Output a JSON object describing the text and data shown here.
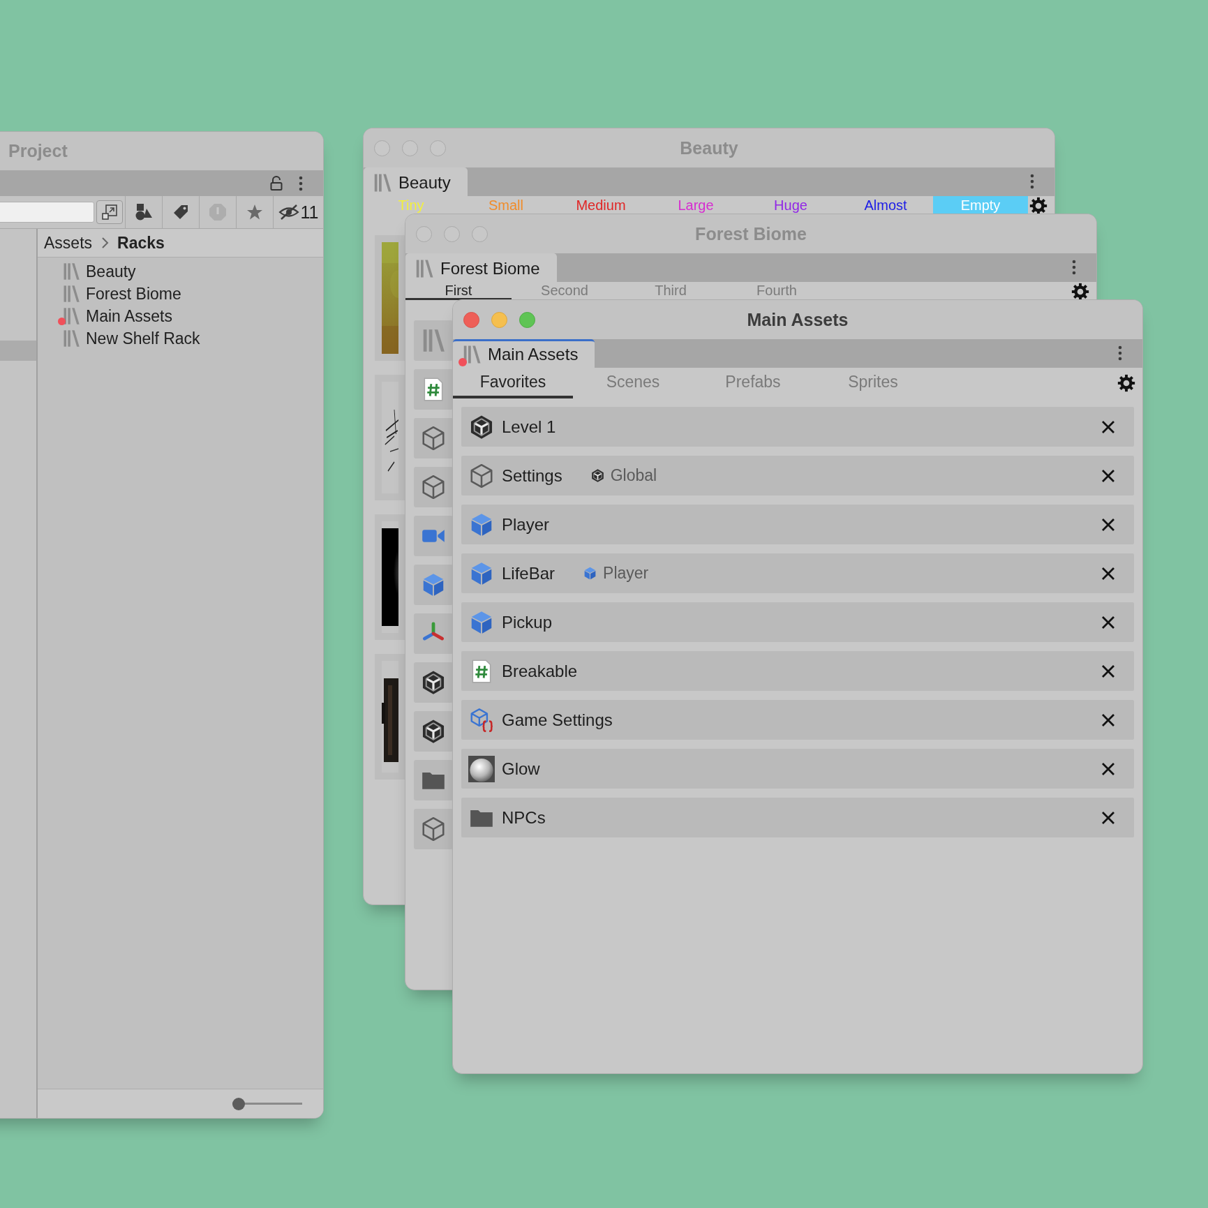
{
  "project_window": {
    "title": "Project",
    "sidebar": {
      "row_selected": true
    },
    "filter_buttons": [
      {
        "kind": "type",
        "disabled": false
      },
      {
        "kind": "label",
        "disabled": false
      },
      {
        "kind": "log",
        "disabled": true
      },
      {
        "kind": "favorite",
        "disabled": false
      }
    ],
    "hidden_count": "11",
    "breadcrumb": [
      {
        "label": "Assets",
        "current": false
      },
      {
        "label": "Racks",
        "current": true
      }
    ],
    "items": [
      {
        "label": "Beauty",
        "modified": false
      },
      {
        "label": "Forest Biome",
        "modified": false
      },
      {
        "label": "Main Assets",
        "modified": true
      },
      {
        "label": "New Shelf Rack",
        "modified": false
      }
    ],
    "zoom_slider": {
      "level": 0
    }
  },
  "beauty_window": {
    "title": "Beauty",
    "active": false,
    "tab": {
      "label": "Beauty",
      "modified": false,
      "focused": false
    },
    "subtabs": [
      {
        "label": "Tiny",
        "color": "#f2f03c",
        "selected": false
      },
      {
        "label": "Small",
        "color": "#f08c2a",
        "selected": false
      },
      {
        "label": "Medium",
        "color": "#e02626",
        "selected": false
      },
      {
        "label": "Large",
        "color": "#d62cd0",
        "selected": false
      },
      {
        "label": "Huge",
        "color": "#9126e6",
        "selected": false
      },
      {
        "label": "Almost",
        "color": "#1c1ce6",
        "selected": false
      },
      {
        "label": "Empty",
        "color": "#5bcdf5",
        "selected": true
      }
    ]
  },
  "forest_window": {
    "title": "Forest Biome",
    "active": false,
    "tab": {
      "label": "Forest Biome",
      "modified": false,
      "focused": false
    },
    "subtabs": [
      {
        "label": "First",
        "selected": true
      },
      {
        "label": "Second",
        "selected": false
      },
      {
        "label": "Third",
        "selected": false
      },
      {
        "label": "Fourth",
        "selected": false
      }
    ],
    "sidebar_icons": [
      {
        "kind": "rack"
      },
      {
        "kind": "script"
      },
      {
        "kind": "box"
      },
      {
        "kind": "box"
      },
      {
        "kind": "camera"
      },
      {
        "kind": "prefab"
      },
      {
        "kind": "gizmo"
      },
      {
        "kind": "unity"
      },
      {
        "kind": "unity"
      },
      {
        "kind": "folder"
      },
      {
        "kind": "box"
      }
    ]
  },
  "main_window": {
    "title": "Main Assets",
    "active": true,
    "tab": {
      "label": "Main Assets",
      "modified": true,
      "focused": true
    },
    "subtabs": [
      {
        "label": "Favorites",
        "selected": true
      },
      {
        "label": "Scenes",
        "selected": false
      },
      {
        "label": "Prefabs",
        "selected": false
      },
      {
        "label": "Sprites",
        "selected": false
      }
    ],
    "items": [
      {
        "label": "Level 1",
        "kind": "unity"
      },
      {
        "label": "Settings",
        "kind": "box",
        "context": {
          "label": "Global",
          "kind": "unity"
        }
      },
      {
        "label": "Player",
        "kind": "prefab"
      },
      {
        "label": "LifeBar",
        "kind": "prefab",
        "context": {
          "label": "Player",
          "kind": "prefab"
        }
      },
      {
        "label": "Pickup",
        "kind": "prefab"
      },
      {
        "label": "Breakable",
        "kind": "script"
      },
      {
        "label": "Game Settings",
        "kind": "config"
      },
      {
        "label": "Glow",
        "kind": "material"
      },
      {
        "label": "NPCs",
        "kind": "folder"
      }
    ]
  }
}
